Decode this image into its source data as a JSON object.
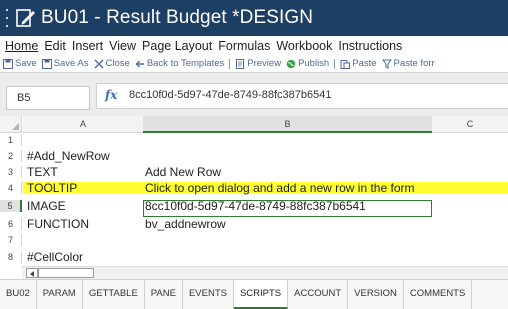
{
  "window": {
    "title": "BU01 - Result Budget *DESIGN",
    "accent": "#1d3f63"
  },
  "menu": {
    "items": [
      "Home",
      "Edit",
      "Insert",
      "View",
      "Page Layout",
      "Formulas",
      "Workbook",
      "Instructions"
    ],
    "active": "Home"
  },
  "toolbar": {
    "save": "Save",
    "save_as": "Save As",
    "close": "Close",
    "back": "Back to Templates",
    "preview": "Preview",
    "publish": "Publish",
    "paste": "Paste",
    "paste_form": "Paste forr"
  },
  "formula_bar": {
    "name_box": "B5",
    "fx": "fx",
    "value": "8cc10f0d-5d97-47de-8749-88fc387b6541"
  },
  "grid": {
    "columns": [
      "A",
      "B",
      "C"
    ],
    "selected_column": "B",
    "selected_row": "5",
    "rows": [
      {
        "num": "1",
        "a": "",
        "b": ""
      },
      {
        "num": "2",
        "a": "#Add_NewRow",
        "b": ""
      },
      {
        "num": "3",
        "a": "TEXT",
        "b": "Add New Row"
      },
      {
        "num": "4",
        "a": "TOOLTIP",
        "b": "Click to open dialog and add a new row in the form",
        "highlight": true
      },
      {
        "num": "5",
        "a": "IMAGE",
        "b": "8cc10f0d-5d97-47de-8749-88fc387b6541"
      },
      {
        "num": "6",
        "a": "FUNCTION",
        "b": "bv_addnewrow"
      },
      {
        "num": "7",
        "a": "",
        "b": ""
      },
      {
        "num": "8",
        "a": "#CellColor",
        "b": ""
      }
    ],
    "highlight_color": "#ffff33",
    "selection_color": "#2e7d32"
  },
  "sheet_tabs": {
    "items": [
      "BU02",
      "PARAM",
      "GETTABLE",
      "PANE",
      "EVENTS",
      "SCRIPTS",
      "ACCOUNT",
      "VERSION",
      "COMMENTS"
    ],
    "active": "SCRIPTS"
  }
}
